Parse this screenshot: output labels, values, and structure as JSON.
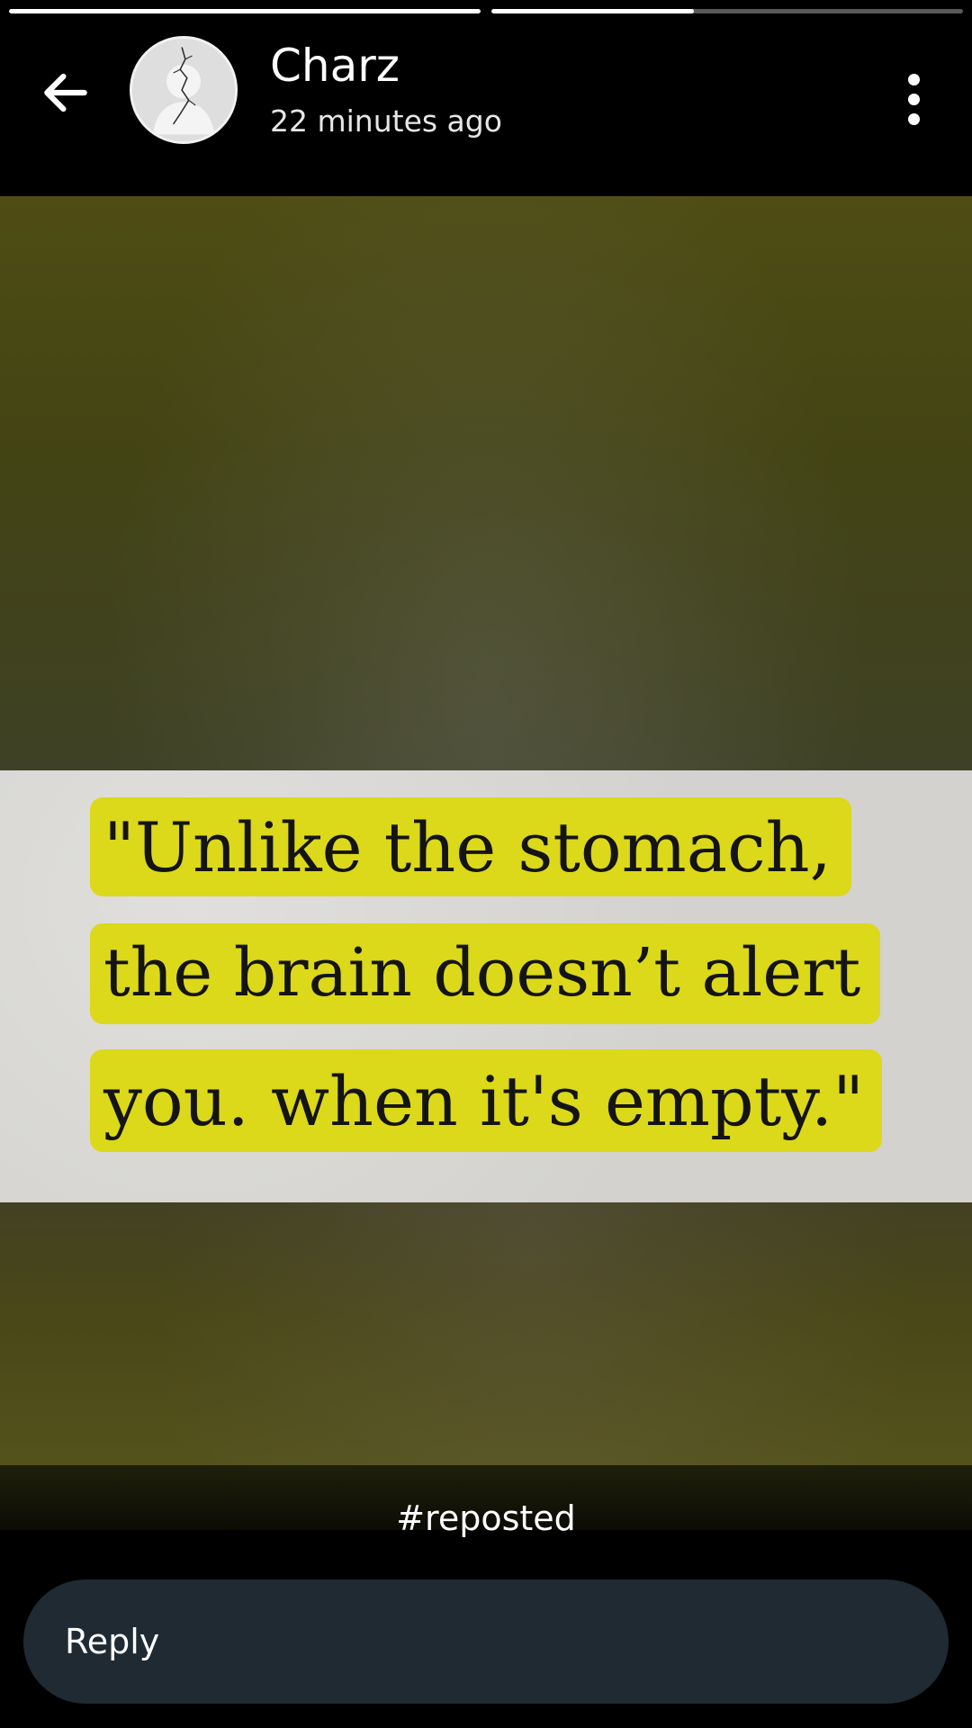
{
  "story": {
    "progress": [
      1.0,
      0.43
    ]
  },
  "header": {
    "name": "Charz",
    "time": "22 minutes ago",
    "back_icon": "arrow-left-icon",
    "menu_icon": "more-vertical-icon"
  },
  "media": {
    "quote_lines": [
      "\"Unlike the stomach,",
      "the brain doesn’t alert",
      "you. when it's empty.\""
    ],
    "highlight_color": "#dcd81a"
  },
  "caption": "#reposted",
  "reply": {
    "placeholder": "Reply"
  }
}
